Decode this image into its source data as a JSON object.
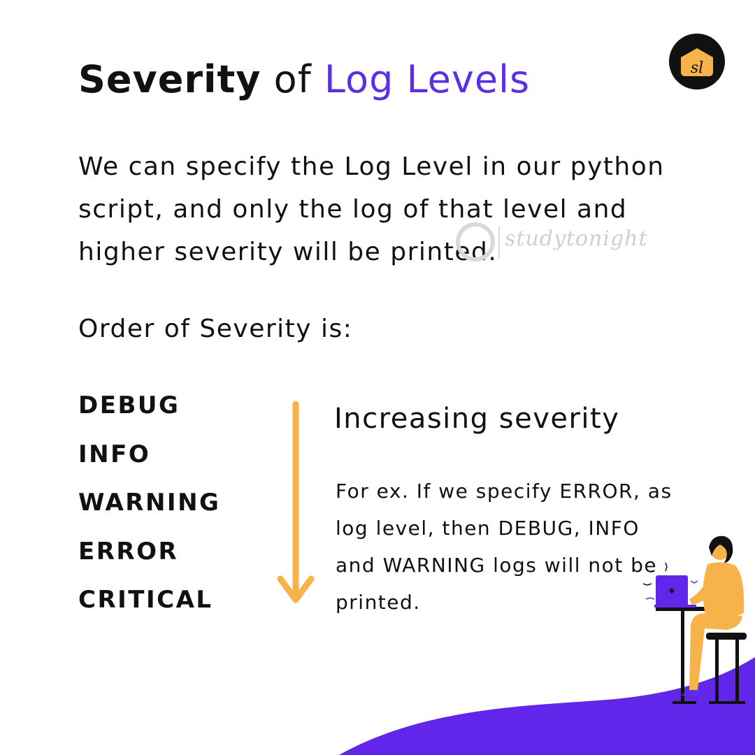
{
  "title": {
    "bold": "Severity",
    "middle": " of ",
    "accent": "Log Levels"
  },
  "intro": "We can specify the Log Level in our python script, and only the log of that level and higher severity will be printed.",
  "order_label": "Order of Severity is:",
  "levels": [
    "DEBUG",
    "INFO",
    "WARNING",
    "ERROR",
    "CRITICAL"
  ],
  "severity_note": "Increasing severity",
  "example": "For ex. If we specify ERROR, as log level, then DEBUG, INFO and WARNING logs will not be printed.",
  "watermark": "studytonight",
  "colors": {
    "accent": "#5b2ee8",
    "arrow": "#f7b34a",
    "logo_bg": "#111111",
    "logo_badge": "#f7b34a",
    "wave": "#6226ea"
  },
  "icons": {
    "logo": "studytonight-logo",
    "arrow": "arrow-down-icon"
  }
}
